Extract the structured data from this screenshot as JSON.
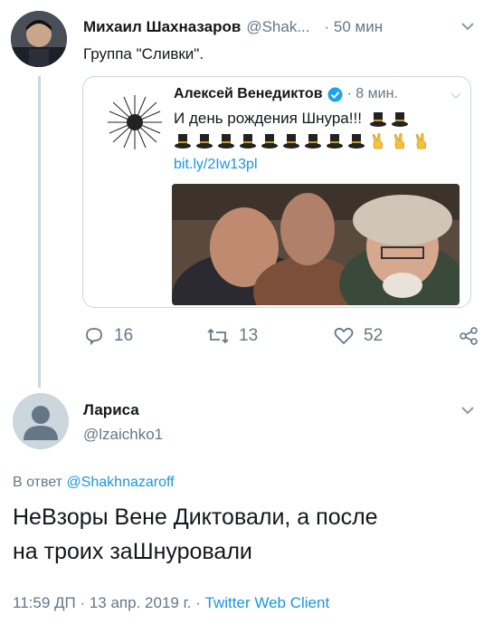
{
  "tweet": {
    "author_name": "Михаил Шахназаров",
    "author_handle": "@Shak...",
    "time": "· 50 мин",
    "text": "Группа \"Сливки\".",
    "quoted": {
      "author_name": "Алексей Венедиктов",
      "time": "· 8 мин.",
      "text_line1": "И день рождения Шнура!!!",
      "link": "bit.ly/2Iw13pl"
    },
    "actions": {
      "replies": "16",
      "retweets": "13",
      "likes": "52"
    }
  },
  "reply": {
    "author_name": "Лариса",
    "author_handle": "@lzaichko1",
    "in_reply_prefix": "В ответ",
    "in_reply_handle": "@Shakhnazaroff",
    "text_line1": "НеВзоры Вене Диктовали, а после",
    "text_line2": "на троих заШнуровали",
    "meta_time": "11:59 ДП · 13 апр. 2019 г. ·",
    "meta_client": "Twitter Web Client"
  },
  "colors": {
    "accent": "#1b95e0",
    "muted": "#657786",
    "border": "#ccd6dd",
    "verified": "#1da1f2"
  },
  "icons": [
    "chevron-down-icon",
    "verified-badge-icon",
    "reply-icon",
    "retweet-icon",
    "like-icon",
    "share-icon",
    "top-hat-emoji",
    "victory-hand-emoji",
    "default-avatar-icon"
  ]
}
